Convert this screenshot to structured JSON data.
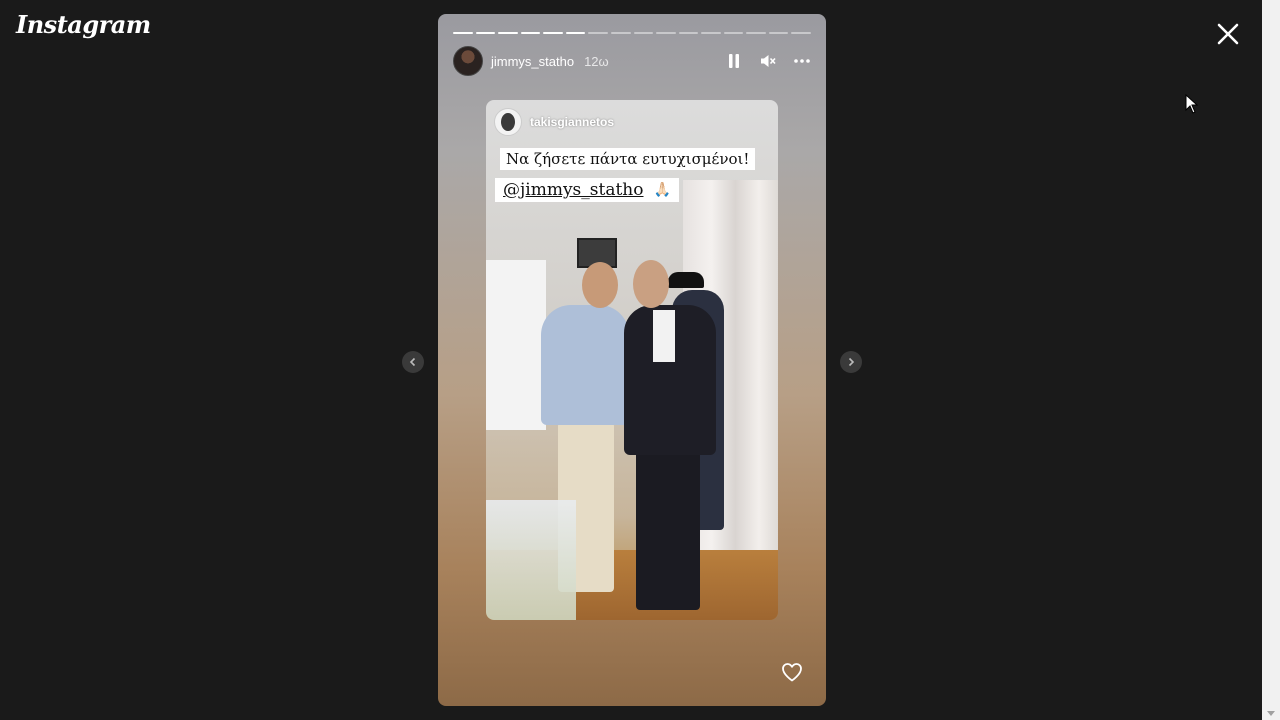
{
  "app": {
    "logo_text": "Instagram"
  },
  "story": {
    "username": "jimmys_statho",
    "time": "12ω",
    "progress_total": 16,
    "progress_done": 6,
    "tagged_user": "takisgiannetos",
    "caption_line1": "Να ζήσετε πάντα ευτυχισμένοι!",
    "caption_mention": "@jimmys_statho",
    "caption_emoji": "🙏🏻"
  },
  "icons": {
    "close": "close-icon",
    "pause": "pause-icon",
    "mute": "mute-icon",
    "more": "more-icon",
    "prev": "chevron-left-icon",
    "next": "chevron-right-icon",
    "like": "heart-icon"
  },
  "colors": {
    "background": "#1a1a1a",
    "text": "#ffffff"
  }
}
